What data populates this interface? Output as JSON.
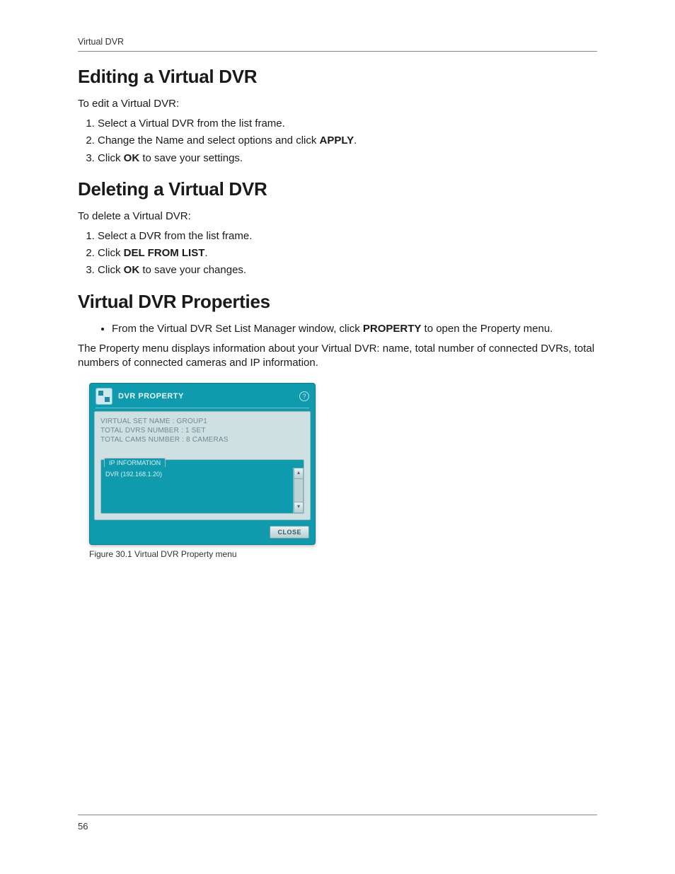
{
  "running_head": "Virtual DVR",
  "page_number": "56",
  "sections": {
    "edit": {
      "title": "Editing a Virtual DVR",
      "lead": "To edit a Virtual DVR:",
      "step1": "Select a Virtual DVR from the list frame.",
      "step2_pre": "Change the Name and select options and click ",
      "step2_bold": "APPLY",
      "step2_post": ".",
      "step3_pre": "Click ",
      "step3_bold": "OK",
      "step3_post": " to save your settings."
    },
    "del": {
      "title": "Deleting a Virtual DVR",
      "lead": "To delete a Virtual DVR:",
      "step1": "Select a DVR from the list frame.",
      "step2_pre": "Click ",
      "step2_bold": "DEL FROM LIST",
      "step2_post": ".",
      "step3_pre": "Click ",
      "step3_bold": "OK",
      "step3_post": " to save your changes."
    },
    "prop": {
      "title": "Virtual DVR Properties",
      "bullet_pre": "From the Virtual DVR Set List Manager window, click ",
      "bullet_bold": "PROPERTY",
      "bullet_post": " to open the Property menu.",
      "body": "The Property menu displays information about your Virtual DVR: name, total number of connected DVRs, total numbers of connected cameras and IP information.",
      "figure_caption": "Figure 30.1 Virtual DVR Property menu"
    }
  },
  "dvr_window": {
    "title": "DVR PROPERTY",
    "help": "?",
    "rows": {
      "r1": "VIRTUAL SET NAME   : GROUP1",
      "r2": "TOTAL DVRS NUMBER  : 1 SET",
      "r3": "TOTAL CAMS NUMBER  : 8 CAMERAS"
    },
    "ip_tab": "IP INFORMATION",
    "ip_line": "DVR (192.168.1.20)",
    "scroll_up": "▴",
    "scroll_down": "▾",
    "close": "CLOSE"
  }
}
